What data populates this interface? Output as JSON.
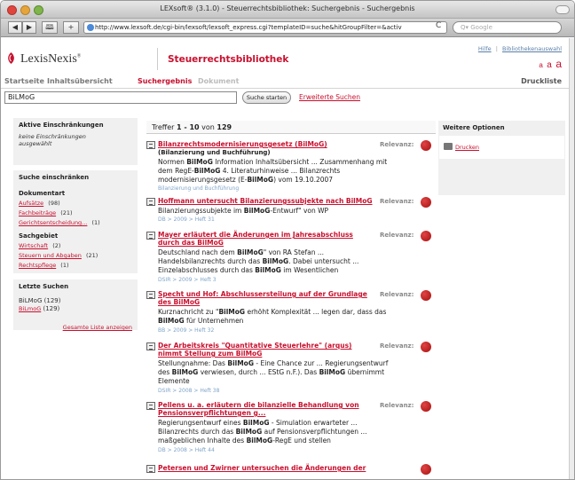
{
  "window": {
    "title": "LEXsoft® (3.1.0) - Steuerrechtsbibliothek: Suchergebnis - Suchergebnis"
  },
  "browser": {
    "back": "◀",
    "forward": "▶",
    "bookmark": "🕮",
    "add": "+",
    "url": "http://www.lexsoft.de/cgi-bin/lexsoft/lexsoft_express.cgi?templateID=suche&hitGroupFilter=&activ",
    "reload": "C",
    "search_placeholder": "Q▾ Google"
  },
  "header": {
    "logo_text": "LexisNexis",
    "logo_sup": "®",
    "brand": "Steuerrechtsbibliothek",
    "hilfe": "Hilfe",
    "separator": "|",
    "bibliothek": "Bibliothekenauswahl",
    "font_small": "a",
    "font_medium": "a",
    "font_large": "a"
  },
  "nav": {
    "startseite": "Startseite",
    "inhaltsuebersicht": "Inhaltsübersicht",
    "suchergebnis": "Suchergebnis",
    "dokument": "Dokument",
    "druckliste": "Druckliste"
  },
  "query": {
    "value": "BiLMoG",
    "button": "Suche starten",
    "erweitert": "Erweiterte Suchen"
  },
  "sidebar": {
    "aktive_title": "Aktive Einschränkungen",
    "aktive_text": "keine Einschränkungen ausgewählt",
    "einschraenken_title": "Suche einschränken",
    "dokumentart_label": "Dokumentart",
    "dokumentart": [
      {
        "label": "Aufsätze",
        "count": "(98)"
      },
      {
        "label": "Fachbeiträge",
        "count": "(21)"
      },
      {
        "label": "Gerichtsentscheidung...",
        "count": "(1)"
      }
    ],
    "sachgebiet_label": "Sachgebiet",
    "sachgebiet": [
      {
        "label": "Wirtschaft",
        "count": "(2)"
      },
      {
        "label": "Steuern und Abgaben",
        "count": "(21)"
      },
      {
        "label": "Rechtspflege",
        "count": "(1)"
      }
    ],
    "letzte_title": "Letzte Suchen",
    "letzte": [
      {
        "label": "BiLMoG",
        "count": "(129)"
      },
      {
        "label": "BiLmoG",
        "count": "(129)"
      }
    ],
    "gesamte": "Gesamte Liste anzeigen"
  },
  "results": {
    "treffer_prefix": "Treffer",
    "range": "1 - 10",
    "von": "von",
    "total": "129",
    "relevanz": "Relevanz:",
    "items": [
      {
        "title": "Bilanzrechtsmodernisierungsgesetz (BilMoG)",
        "subtitle": "(Bilanzierung und Buchführung)",
        "snippet_html": "Normen <b>BilMoG</b> Information Inhaltsübersicht ... Zusammenhang mit dem RegE-<b>BilMoG</b> 4. Literaturhinweise ... Bilanzrechts modernisierungsgesetz (E-<b>BilMoG</b>) vom 19.10.2007",
        "source": "Bilanzierung und Buchführung"
      },
      {
        "title": "Hoffmann untersucht Bilanzierungssubjekte nach BilMoG",
        "snippet_html": "Bilanzierungssubjekte im <b>BilMoG</b>-Entwurf\" von WP",
        "source": "DB > 2009 > Heft 31"
      },
      {
        "title": "Mayer erläutert die Änderungen im Jahresabschluss durch das BilMoG",
        "snippet_html": "Deutschland nach dem <b>BilMoG</b>\" von RA Stefan ... Handelsbilanzrechts durch das <b>BilMoG</b>. Dabei untersucht ... Einzelabschlusses durch das <b>BilMoG</b> im Wesentlichen",
        "source": "DSIR > 2009 > Heft 3"
      },
      {
        "title": "Specht und Hof: Abschlussersteilung auf der Grundlage des BilMoG",
        "snippet_html": "Kurznachricht zu \"<b>BilMoG</b> erhöht Komplexität ... legen dar, dass das <b>BilMoG</b> für Unternehmen",
        "source": "BB > 2009 > Heft 32"
      },
      {
        "title": "Der Arbeitskreis \"Quantitative Steuerlehre\" (arqus) nimmt Stellung zum BilMoG",
        "snippet_html": "Stellungnahme: Das <b>BilMoG</b> - Eine Chance zur ... Regierungsentwurf des <b>BilMoG</b> verwiesen, durch ... EStG n.F.). Das <b>BilMoG</b> übernimmt Elemente",
        "source": "DSIR > 2008 > Heft 38"
      },
      {
        "title": "Pellens u. a. erläutern die bilanzielle Behandlung von Pensionsverpflichtungen g...",
        "snippet_html": "Regierungsentwurf eines <b>BilMoG</b> - Simulation erwarteter ... Bilanzrechts durch das <b>BilMoG</b> auf Pensionsverpflichtungen ... maßgeblichen Inhalte des <b>BilMoG</b>-RegE und stellen",
        "source": "DB > 2008 > Heft 44"
      },
      {
        "title": "Petersen und Zwirner untersuchen die Änderungen der",
        "snippet_html": "",
        "source": ""
      }
    ]
  },
  "options": {
    "title": "Weitere Optionen",
    "drucken": "Drucken"
  },
  "colors": {
    "brand_red": "#c8102e",
    "link_blue": "#5a7fa8",
    "panel_gray": "#f0f0f0"
  }
}
